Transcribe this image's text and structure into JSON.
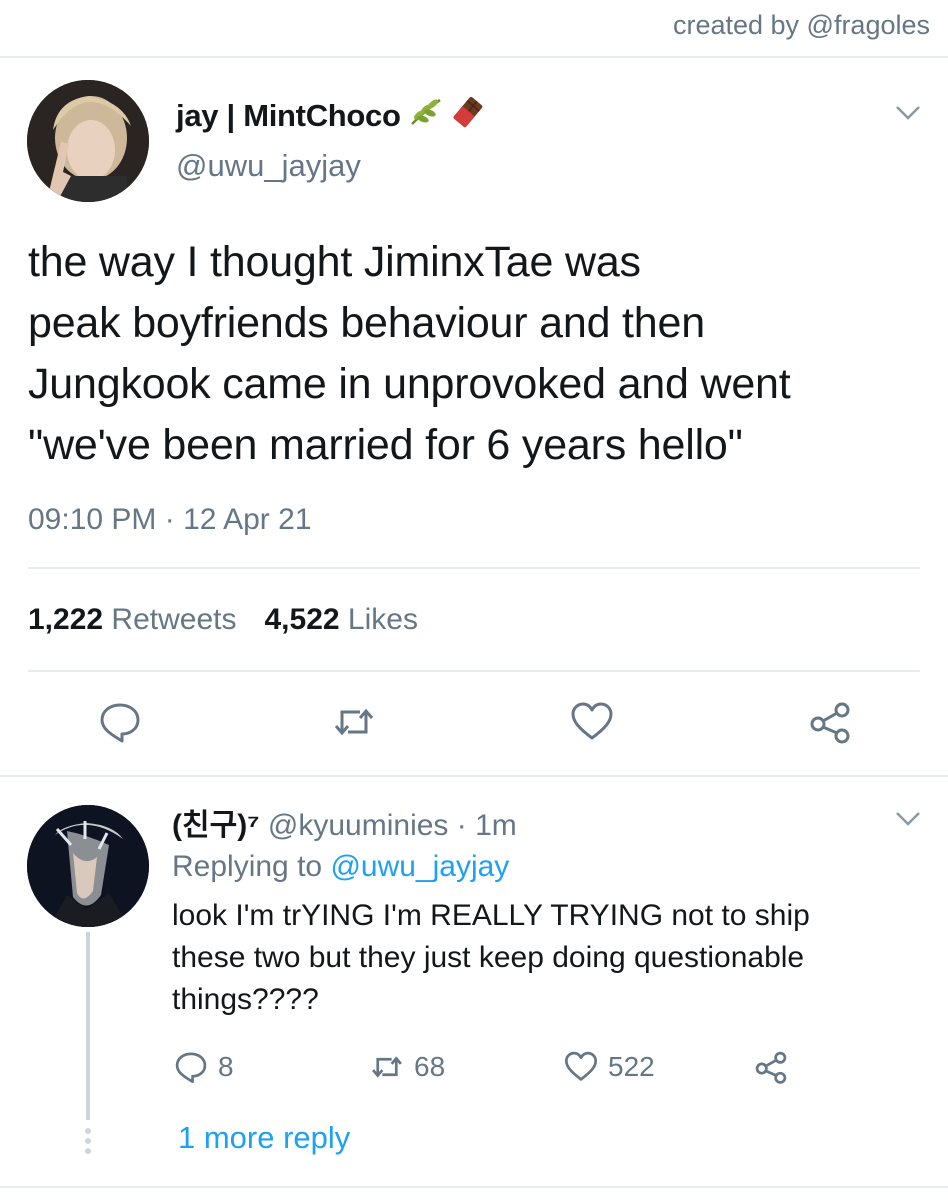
{
  "credit": "created by @fragoles",
  "main_tweet": {
    "display_name": "jay | MintChoco",
    "name_emojis": [
      "herb-icon",
      "chocolate-bar-icon"
    ],
    "handle": "@uwu_jayjay",
    "text_lines": [
      "the way I thought JiminxTae was",
      "peak boyfriends behaviour and then",
      "Jungkook came in unprovoked and went",
      "\"we've been married for 6 years hello\""
    ],
    "timestamp": "09:10 PM · 12 Apr 21",
    "retweets_count": "1,222",
    "retweets_label": "Retweets",
    "likes_count": "4,522",
    "likes_label": "Likes",
    "actions": [
      "reply-icon",
      "retweet-icon",
      "like-icon",
      "share-icon"
    ]
  },
  "reply_tweet": {
    "display_name": "(친구)⁷",
    "handle_time": "@kyuuminies · 1m",
    "replying_prefix": "Replying to",
    "replying_to": "@uwu_jayjay",
    "text_lines": [
      "look I'm trYING I'm REALLY TRYING not to ship",
      "these two but they just keep doing questionable",
      "things????"
    ],
    "reply_count": "8",
    "retweet_count": "68",
    "like_count": "522",
    "more_replies": "1 more reply"
  },
  "colors": {
    "text": "#14171a",
    "secondary": "#657786",
    "link": "#1da1f2",
    "divider": "#e6ecf0"
  }
}
